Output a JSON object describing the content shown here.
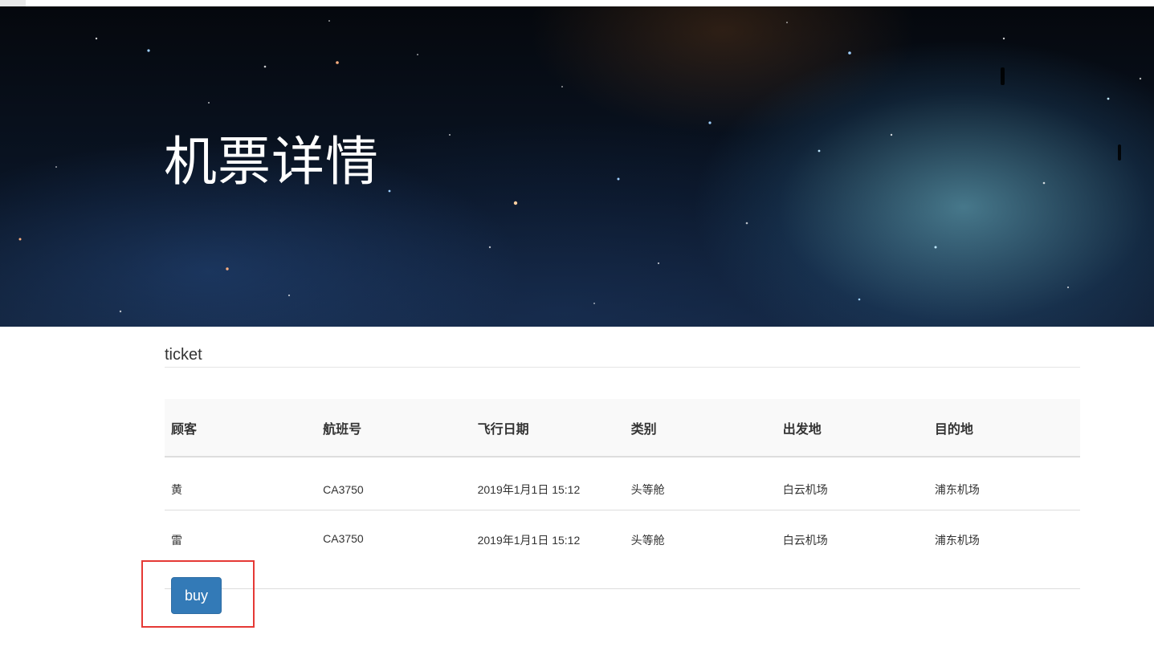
{
  "hero": {
    "title": "机票详情"
  },
  "section": {
    "title": "ticket"
  },
  "table": {
    "headers": [
      "顾客",
      "航班号",
      "飞行日期",
      "类别",
      "出发地",
      "目的地"
    ],
    "rows": [
      [
        "黄",
        "CA3750",
        "2019年1月1日 15:12",
        "头等舱",
        "白云机场",
        "浦东机场"
      ],
      [
        "雷",
        "CA3750",
        "2019年1月1日 15:12",
        "头等舱",
        "白云机场",
        "浦东机场"
      ]
    ]
  },
  "actions": {
    "buy_label": "buy"
  },
  "colors": {
    "primary": "#337ab7",
    "highlight": "#e53935"
  }
}
